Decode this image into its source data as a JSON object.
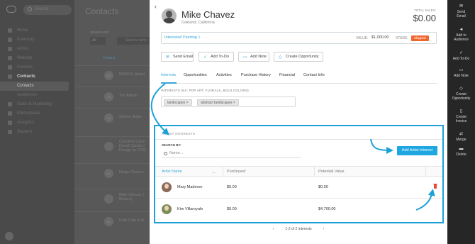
{
  "app": {
    "search_placeholder": "Search",
    "nav": [
      {
        "label": "Home",
        "icon": "home-icon"
      },
      {
        "label": "Inventory",
        "icon": "box-icon"
      },
      {
        "label": "Artists",
        "icon": "palette-icon"
      },
      {
        "label": "Website",
        "icon": "globe-icon"
      },
      {
        "label": "Invoices",
        "icon": "invoice-icon"
      },
      {
        "label": "Contacts",
        "icon": "people-icon"
      },
      {
        "label": "Contacts",
        "icon": ""
      },
      {
        "label": "Audiences",
        "icon": ""
      },
      {
        "label": "Sales & Marketing",
        "icon": "chart-icon"
      },
      {
        "label": "Marketplace",
        "icon": "store-icon"
      },
      {
        "label": "Analytics",
        "icon": "analytics-icon"
      },
      {
        "label": "Support",
        "icon": "help-icon"
      }
    ]
  },
  "contacts_list": {
    "title": "Contacts",
    "search_by_label": "SEARCH BY:",
    "filter_value": "All",
    "search_placeholder": "Search name",
    "column_header": "Contact",
    "rows": [
      {
        "initials": "MA",
        "name": "MERCH (jewel"
      },
      {
        "initials": "TA",
        "name": "Tim Abbott"
      },
      {
        "initials": "SA",
        "name": "Steven Abba"
      },
      {
        "initials": "",
        "name": "Christine Cane\nDavid Canelo i\nDesign by CCG"
      },
      {
        "initials": "DC",
        "name": "Diego Chavez"
      },
      {
        "initials": "",
        "name": "Mike Chavez (\nMotors)"
      },
      {
        "initials": "KC",
        "name": "Kate Cola & N"
      }
    ]
  },
  "contact": {
    "name": "Mike Chavez",
    "location": "Oakland, California",
    "total_sales_label": "TOTAL SALES:",
    "total_sales_value": "$0.00"
  },
  "opportunity": {
    "name": "Interested Painting 1",
    "value_label": "VALUE:",
    "value": "$1,000.00",
    "stage_label": "STAGE:",
    "stage": "Shipped",
    "stage_color": "#f0662f"
  },
  "actions": [
    {
      "label": "Send Email",
      "icon": "envelope-icon"
    },
    {
      "label": "Add To-Do",
      "icon": "check-icon"
    },
    {
      "label": "Add Note",
      "icon": "note-icon"
    },
    {
      "label": "Create Opportunity",
      "icon": "opportunity-icon"
    }
  ],
  "tabs": [
    "Interests",
    "Opportunities",
    "Activities",
    "Purchase History",
    "Financial",
    "Contact Info"
  ],
  "interests": {
    "label": "INTERESTS (EX: POP ART, FLORALS, BOLD COLORS)",
    "tags": [
      "landscapes",
      "abstract landscapes"
    ]
  },
  "artist_interests": {
    "section_label": "ARTIST INTERESTS",
    "search_by_label": "SEARCH BY:",
    "search_placeholder": "Name...",
    "add_button": "Add Artist Interest",
    "columns": [
      "Artist Name",
      "Purchased",
      "Potential Value"
    ],
    "rows": [
      {
        "name": "Mary Maderon",
        "purchased": "$0.00",
        "potential": "$0.00"
      },
      {
        "name": "Kim Villaroyale",
        "purchased": "$0.00",
        "potential": "$4,700.00"
      }
    ],
    "pagination": "1-2 of 2 interests"
  },
  "rail": [
    {
      "label": "Send\nEmail",
      "icon": "envelope-icon",
      "glyph": "✉"
    },
    {
      "label": "Add to\nAudience",
      "icon": "megaphone-icon",
      "glyph": "📢"
    },
    {
      "label": "Add To-Do",
      "icon": "check-icon",
      "glyph": "✓"
    },
    {
      "label": "Add Note",
      "icon": "note-icon",
      "glyph": "▭"
    },
    {
      "label": "Create\nOpportunity",
      "icon": "tag-icon",
      "glyph": "◇"
    },
    {
      "label": "Create\nInvoice",
      "icon": "invoice-icon",
      "glyph": "▯"
    },
    {
      "label": "Merge",
      "icon": "merge-icon",
      "glyph": "⇄"
    },
    {
      "label": "Delete",
      "icon": "trash-icon",
      "glyph": "🗑"
    }
  ],
  "colors": {
    "accent": "#1da1d8",
    "annotation": "#1da1d8",
    "delete": "#e24d3c"
  }
}
